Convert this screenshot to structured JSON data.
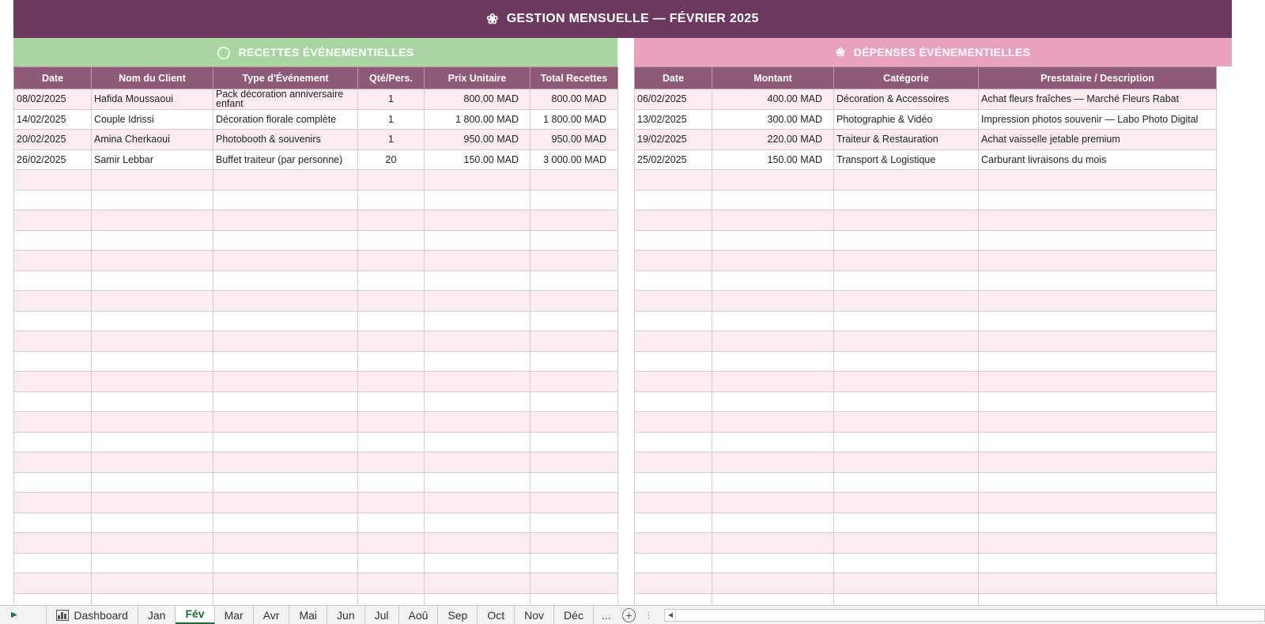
{
  "title": {
    "icon": "flower-icon",
    "glyph": "❀",
    "text": "GESTION MENSUELLE — FÉVRIER 2025"
  },
  "recettes": {
    "icon": "money-bag-icon",
    "glyph": "💰",
    "title": "RECETTES ÉVÉNEMENTIELLES",
    "headers": [
      "Date",
      "Nom du Client",
      "Type d'Événement",
      "Qté/Pers.",
      "Prix Unitaire",
      "Total Recettes"
    ],
    "rows": [
      [
        "08/02/2025",
        "Hafida Moussaoui",
        "Pack décoration anniversaire enfant",
        "1",
        "800.00 MAD",
        "800.00 MAD"
      ],
      [
        "14/02/2025",
        "Couple Idrissi",
        "Décoration florale complète",
        "1",
        "1 800.00 MAD",
        "1 800.00 MAD"
      ],
      [
        "20/02/2025",
        "Amina Cherkaoui",
        "Photobooth & souvenirs",
        "1",
        "950.00 MAD",
        "950.00 MAD"
      ],
      [
        "26/02/2025",
        "Samir Lebbar",
        "Buffet traiteur (par personne)",
        "20",
        "150.00 MAD",
        "3 000.00 MAD"
      ]
    ]
  },
  "depenses": {
    "icon": "flower-icon",
    "glyph": "❀",
    "title": "DÉPENSES ÉVÉNEMENTIELLES",
    "headers": [
      "Date",
      "Montant",
      "Catégorie",
      "Prestataire / Description"
    ],
    "rows": [
      [
        "06/02/2025",
        "400.00 MAD",
        "Décoration & Accessoires",
        "Achat fleurs fraîches — Marché Fleurs Rabat"
      ],
      [
        "13/02/2025",
        "300.00 MAD",
        "Photographie & Vidéo",
        "Impression photos souvenir — Labo Photo Digital"
      ],
      [
        "19/02/2025",
        "220.00 MAD",
        "Traiteur & Restauration",
        "Achat vaisselle jetable premium"
      ],
      [
        "25/02/2025",
        "150.00 MAD",
        "Transport & Logistique",
        "Carburant livraisons du mois"
      ]
    ]
  },
  "tabs": {
    "items": [
      "Dashboard",
      "Jan",
      "Fév",
      "Mar",
      "Avr",
      "Mai",
      "Jun",
      "Jul",
      "Aoû",
      "Sep",
      "Oct",
      "Nov",
      "Déc"
    ],
    "active": "Fév",
    "more": "...",
    "add": "+"
  }
}
